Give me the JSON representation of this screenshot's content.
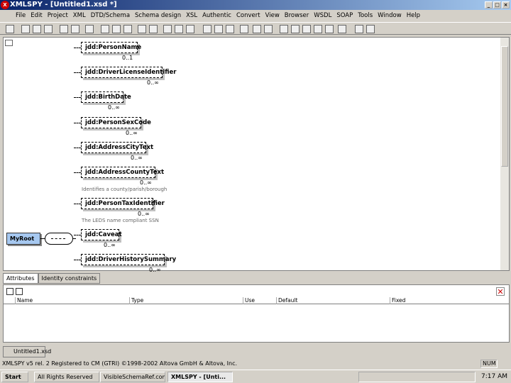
{
  "window": {
    "title": "XMLSPY - [Untitled1.xsd *]",
    "logo": "XS"
  },
  "menu": [
    "File",
    "Edit",
    "Project",
    "XML",
    "DTD/Schema",
    "Schema design",
    "XSL",
    "Authentic",
    "Convert",
    "View",
    "Browser",
    "WSDL",
    "SOAP",
    "Tools",
    "Window",
    "Help"
  ],
  "diagram": {
    "root": "MyRoot",
    "elements": [
      {
        "name": "jdd:PersonName",
        "card": "0..1"
      },
      {
        "name": "jdd:DriverLicenseIdentifier",
        "card": "0..∞"
      },
      {
        "name": "jdd:BirthDate",
        "card": "0..∞"
      },
      {
        "name": "jdd:PersonSexCode",
        "card": "0..∞"
      },
      {
        "name": "jdd:AddressCityText",
        "card": "0..∞"
      },
      {
        "name": "jdd:AddressCountyText",
        "card": "0..∞",
        "annotation": "Identifies a county/parish/borough"
      },
      {
        "name": "jdd:PersonTaxIdentifier",
        "card": "0..∞",
        "annotation": "The LEDS name compliant SSN"
      },
      {
        "name": "jdd:Caveat",
        "card": "0..∞"
      },
      {
        "name": "jdd:DriverHistorySummary",
        "card": "0..∞"
      }
    ]
  },
  "tabs": [
    "Attributes",
    "Identity constraints"
  ],
  "attributes": {
    "columns": [
      "Name",
      "Type",
      "Use",
      "Default",
      "Fixed"
    ]
  },
  "doc_tab": "Untitled1.xsd",
  "status": {
    "text": "XMLSPY v5 rel. 2   Registered to CM (GTRI)   ©1998-2002 Altova GmbH & Altova, Inc.",
    "num": "NUM"
  },
  "taskbar": {
    "start": "Start",
    "tasks": [
      "All Rights Reserved",
      "VisibleSchemaRef.com",
      "XMLSPY - [Unti..."
    ],
    "clock": "7:17 AM"
  }
}
